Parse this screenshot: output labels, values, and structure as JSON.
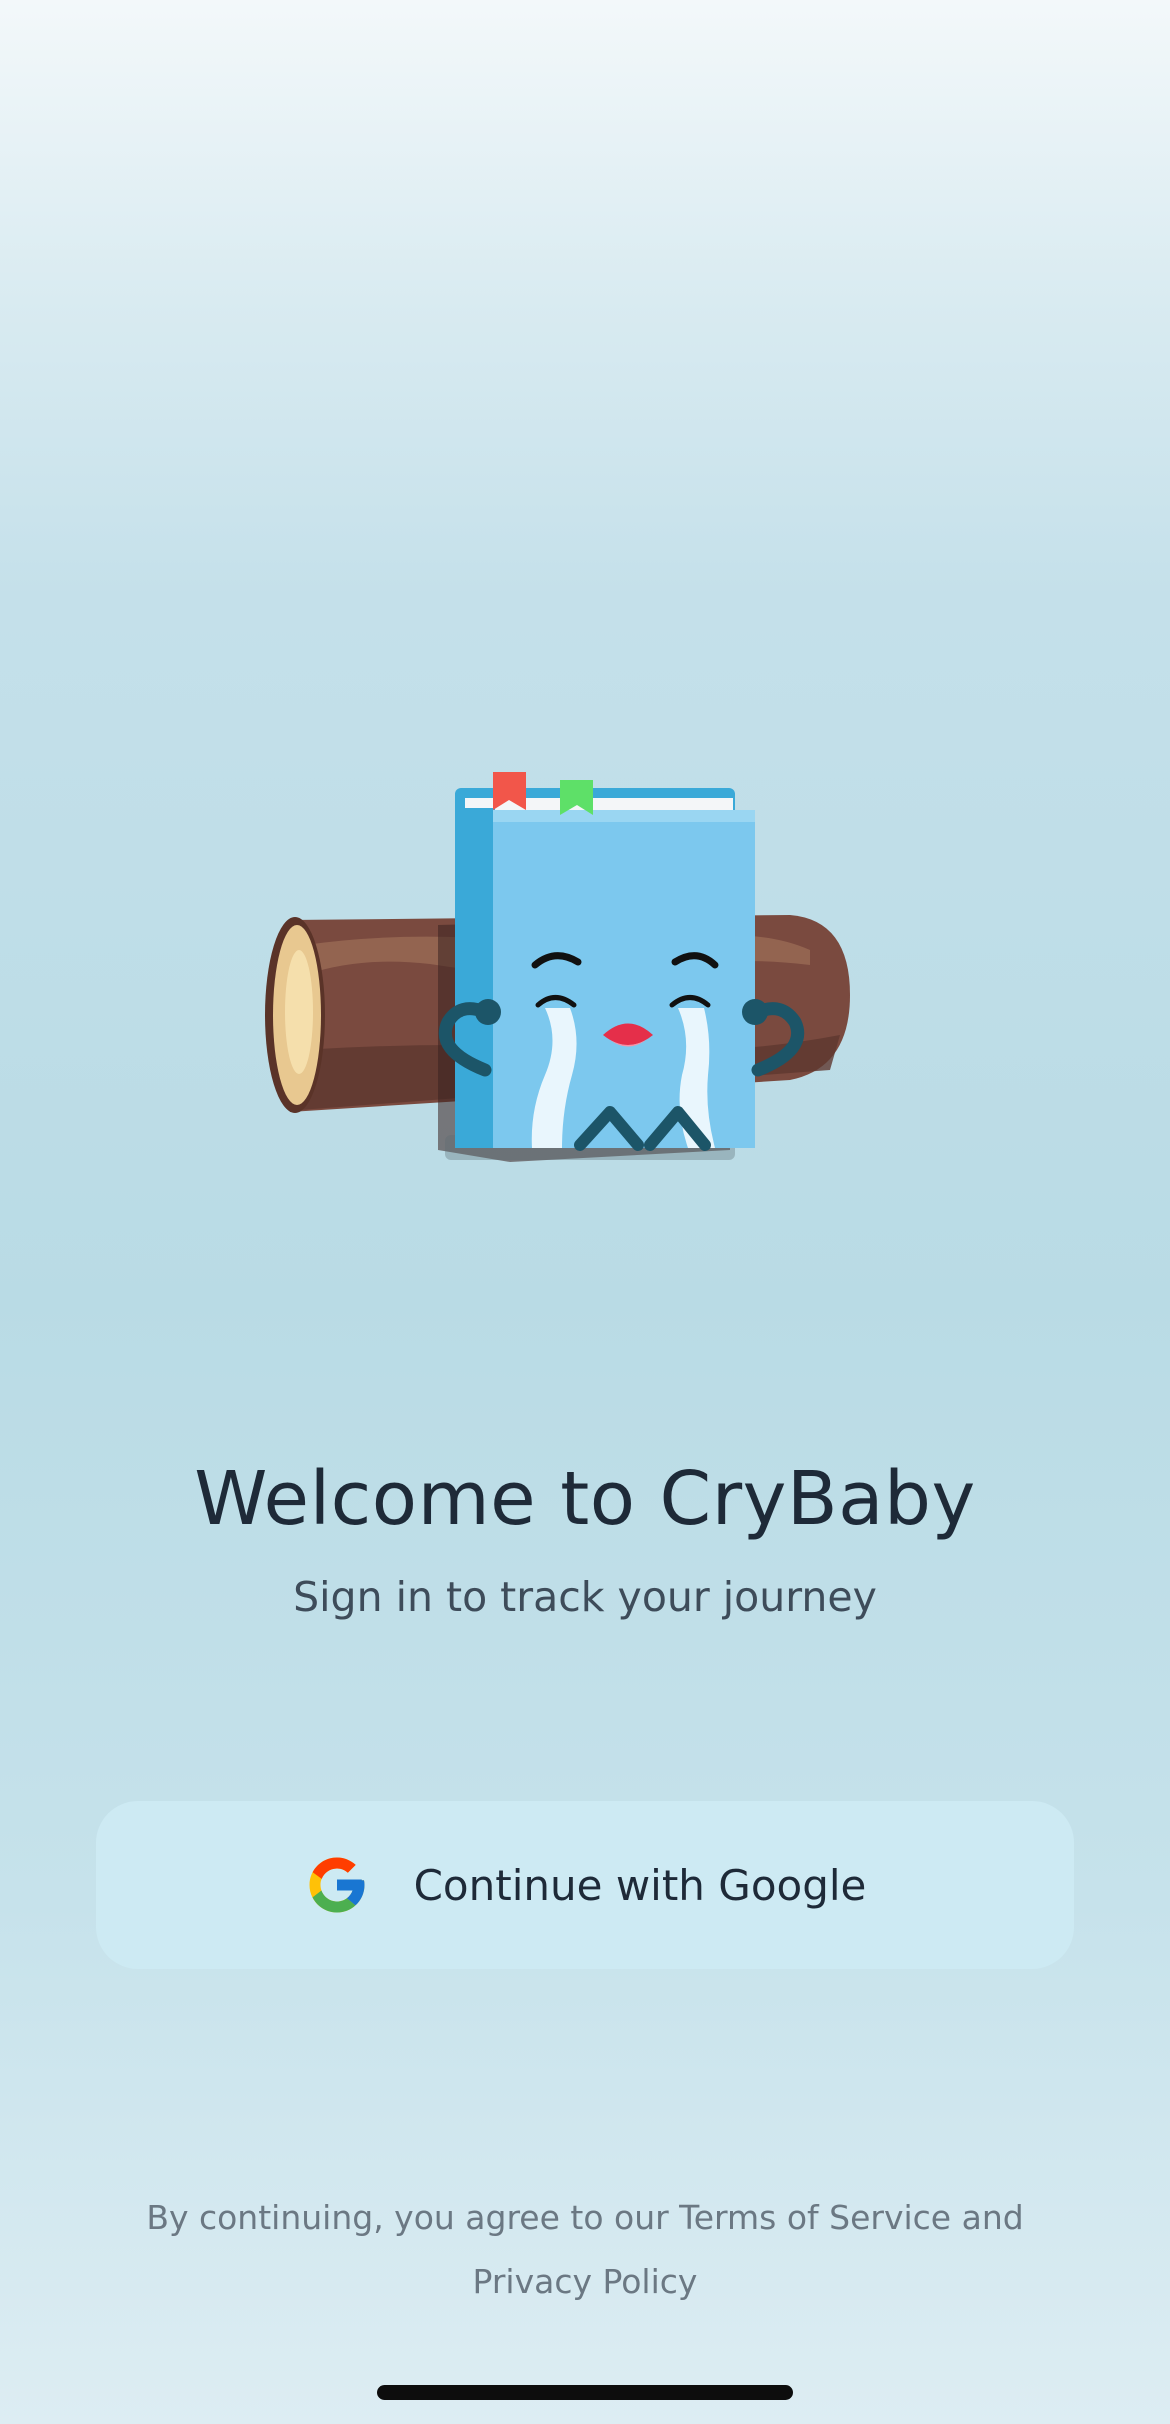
{
  "app": {
    "name": "CryBaby"
  },
  "mascot": {
    "description_icon": "crying-book-on-log-icon"
  },
  "welcome": {
    "title": "Welcome to CryBaby",
    "subtitle": "Sign in to track your journey"
  },
  "auth": {
    "google_button_label": "Continue with Google",
    "google_icon": "google-icon"
  },
  "legal": {
    "terms_text": "By continuing, you agree to our Terms of Service and Privacy Policy"
  },
  "colors": {
    "title": "#1e2a38",
    "button_bg": "#cdeaf3",
    "book_blue": "#7cc8ee",
    "log_brown": "#7a4a3f"
  }
}
